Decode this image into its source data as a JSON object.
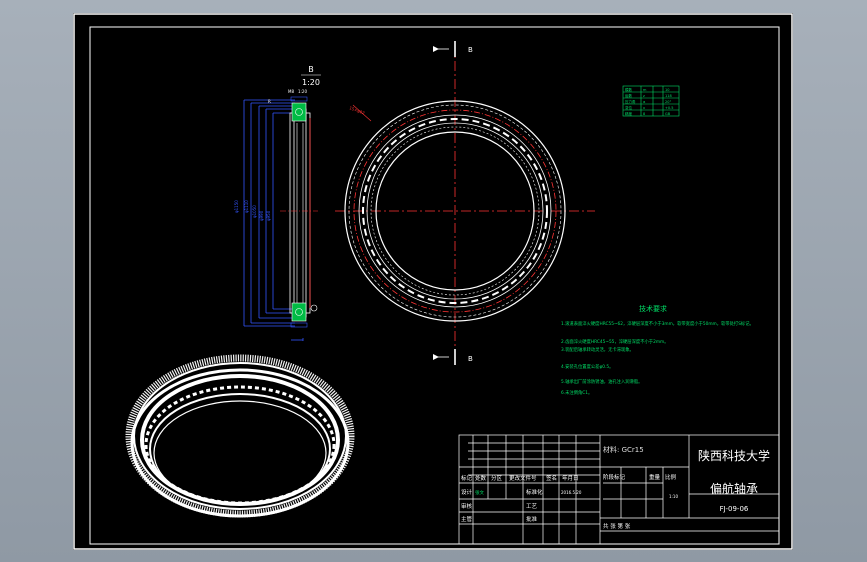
{
  "drawing": {
    "section_label_top": "B",
    "section_label_bottom": "B",
    "detail_view": {
      "letter": "B",
      "scale": "1:20"
    },
    "notes_title": "技术要求",
    "notes_lines": [
      "1.滚道表面淬火硬度HRC55~62，淬硬层深度不小于3mm，软带宽度小于50mm，软带处打S标记。",
      "2.齿面淬火硬度HRC45~55，淬硬层深度不小于2mm。",
      "3.装配后轴承转动灵活，无卡滞现象。",
      "4.安装孔位置度公差φ0.5。",
      "5.轴承出厂前涂防锈油，油孔注入润滑脂。",
      "6.未注倒角C1。"
    ]
  },
  "title_block": {
    "material": "材料: GCr15",
    "school": "陕西科技大学",
    "part_name": "偏航轴承",
    "drawing_no": "FJ-09-06",
    "scale_header": "比例",
    "scale": "1:10",
    "stage_mark": "阶段标记",
    "weight": "重量",
    "quantity": "共  张  第  张",
    "rev_headers": [
      "标记",
      "处数",
      "分区",
      "更改文件号",
      "签名",
      "年月日"
    ],
    "design_label": "设计",
    "design_name": "张文",
    "date": "2016.5.20",
    "standardize": "标准化",
    "process": "工艺",
    "audit": "审核",
    "approve": "批准",
    "chief": "主管"
  }
}
